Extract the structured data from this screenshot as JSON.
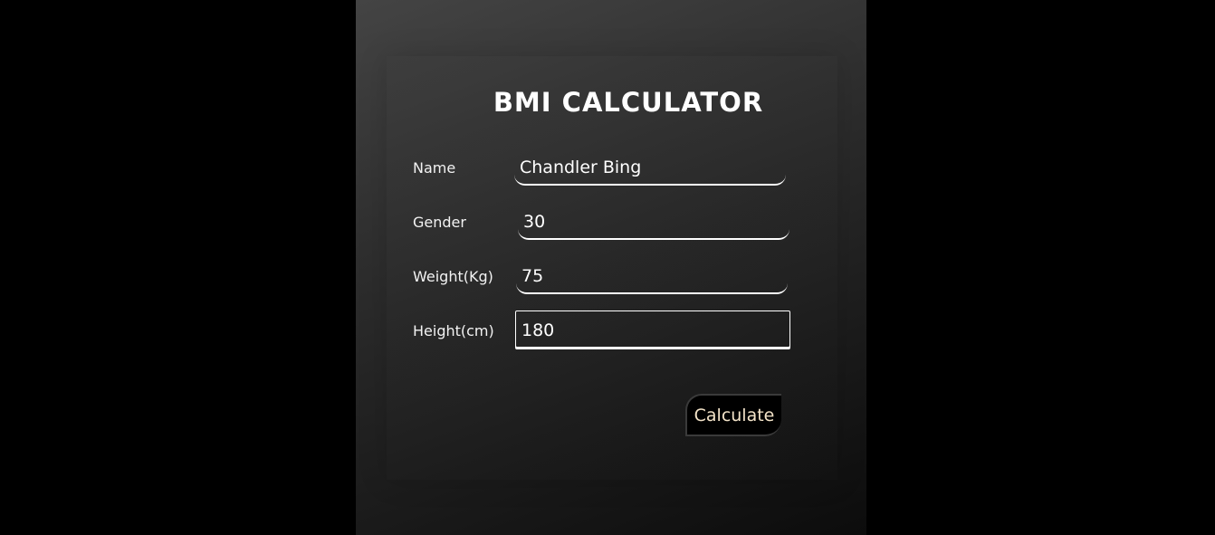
{
  "app": {
    "title": "BMI CALCULATOR"
  },
  "form": {
    "fields": [
      {
        "label": "Name",
        "value": "Chandler Bing"
      },
      {
        "label": "Gender",
        "value": "30"
      },
      {
        "label": "Weight(Kg)",
        "value": "75"
      },
      {
        "label": "Height(cm)",
        "value": "180"
      }
    ],
    "submit_label": "Calculate"
  },
  "colors": {
    "page_background": "#000000",
    "panel_background": "#2f2f2f",
    "text": "#ffffff",
    "button_text": "#f3e3c8",
    "button_background": "#000000"
  }
}
